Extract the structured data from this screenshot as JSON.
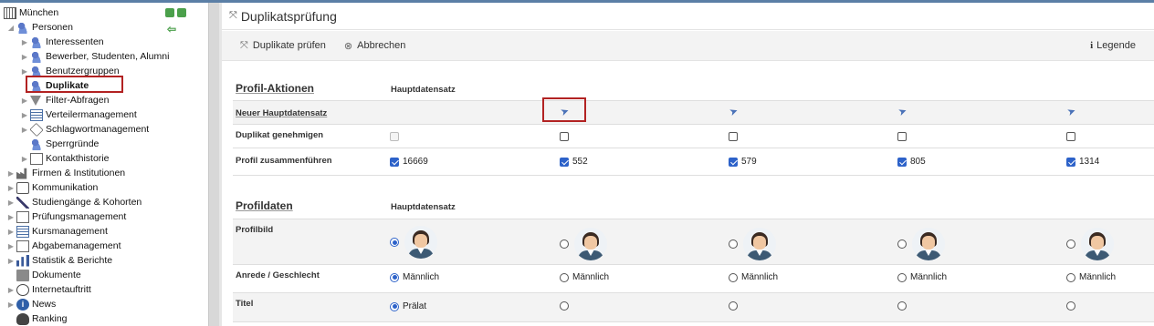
{
  "sidebar": {
    "items": [
      {
        "label": "München",
        "icon": "building-icon"
      },
      {
        "label": "Personen",
        "icon": "people-icon"
      },
      {
        "label": "Interessenten",
        "icon": "people-icon"
      },
      {
        "label": "Bewerber, Studenten, Alumni",
        "icon": "people-icon"
      },
      {
        "label": "Benutzergruppen",
        "icon": "people-icon"
      },
      {
        "label": "Duplikate",
        "icon": "people-icon",
        "selected": true
      },
      {
        "label": "Filter-Abfragen",
        "icon": "filter-icon"
      },
      {
        "label": "Verteilermanagement",
        "icon": "list-icon"
      },
      {
        "label": "Schlagwortmanagement",
        "icon": "tag-icon"
      },
      {
        "label": "Sperrgründe",
        "icon": "people-icon"
      },
      {
        "label": "Kontakthistorie",
        "icon": "history-icon"
      },
      {
        "label": "Firmen & Institutionen",
        "icon": "factory-icon"
      },
      {
        "label": "Kommunikation",
        "icon": "chat-icon"
      },
      {
        "label": "Studiengänge & Kohorten",
        "icon": "quill-icon"
      },
      {
        "label": "Prüfungsmanagement",
        "icon": "document-icon"
      },
      {
        "label": "Kursmanagement",
        "icon": "book-icon"
      },
      {
        "label": "Abgabemanagement",
        "icon": "inbox-icon"
      },
      {
        "label": "Statistik & Berichte",
        "icon": "chart-icon"
      },
      {
        "label": "Dokumente",
        "icon": "folder-icon"
      },
      {
        "label": "Internetauftritt",
        "icon": "globe-icon"
      },
      {
        "label": "News",
        "icon": "info-icon"
      },
      {
        "label": "Ranking",
        "icon": "ranking-icon"
      }
    ]
  },
  "header": {
    "title": "Duplikatsprüfung"
  },
  "toolbar": {
    "check_label": "Duplikate prüfen",
    "cancel_label": "Abbrechen",
    "legend_label": "Legende"
  },
  "profil_aktionen": {
    "title": "Profil-Aktionen",
    "master_header": "Hauptdatensatz",
    "rows": {
      "new_master": "Neuer Hauptdatensatz",
      "approve_duplicate": "Duplikat genehmigen",
      "merge_profile": "Profil zusammenführen"
    },
    "ids": [
      "16669",
      "552",
      "579",
      "805",
      "1314"
    ]
  },
  "profildaten": {
    "title": "Profildaten",
    "master_header": "Hauptdatensatz",
    "rows": {
      "profile_image": "Profilbild",
      "salutation": "Anrede / Geschlecht",
      "title": "Titel"
    },
    "salutations": [
      "Männlich",
      "Männlich",
      "Männlich",
      "Männlich",
      "Männlich"
    ],
    "titles": [
      "Prälat",
      "",
      "",
      "",
      ""
    ]
  }
}
